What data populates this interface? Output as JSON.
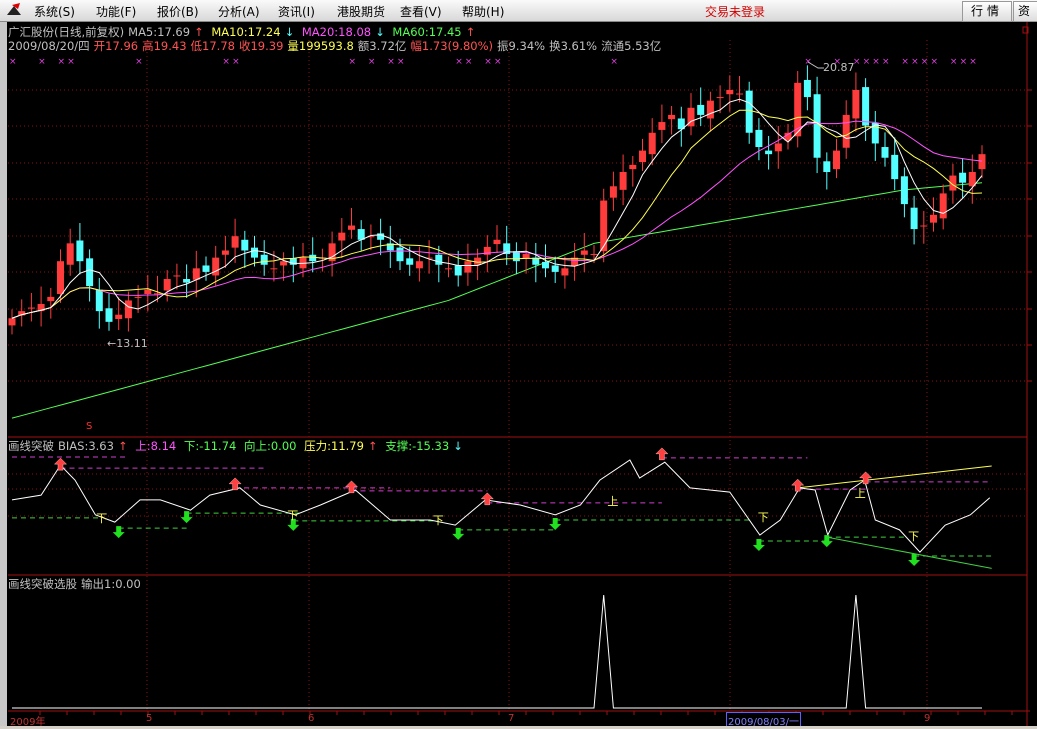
{
  "menu": {
    "items": [
      "系统(S)",
      "功能(F)",
      "报价(B)",
      "分析(A)",
      "资讯(I)",
      "港股期货",
      "查看(V)",
      "帮助(H)"
    ],
    "trade_status": "交易未登录",
    "buttons": [
      "行情",
      "资"
    ]
  },
  "main": {
    "title": "广汇股份(日线,前复权)",
    "ma5": "MA5:17.69",
    "ma10": "MA10:17.24",
    "ma20": "MA20:18.08",
    "ma60": "MA60:17.45",
    "date": "2009/08/20/四",
    "open": "开17.96",
    "high": "高19.43",
    "low": "低17.78",
    "close": "收19.39",
    "volume": "量199593.8",
    "amount": "额3.72亿",
    "change": "幅1.73(9.80%)",
    "amplitude": "振9.34%",
    "turnover": "换3.61%",
    "float": "流通5.53亿",
    "high_marker": "20.87",
    "low_marker": "←13.11",
    "s_marker": "S"
  },
  "indicator": {
    "name": "画线突破",
    "bias": "BIAS:3.63",
    "up": "上:8.14",
    "down": "下:-11.74",
    "upward": "向上:0.00",
    "pressure": "压力:11.79",
    "support": "支撑:-15.33",
    "label_down": "下",
    "label_up": "上"
  },
  "selector": {
    "name": "画线突破选股",
    "output": "输出1:0.00"
  },
  "xaxis": {
    "labels": [
      "2009年",
      "5",
      "6",
      "7",
      "9"
    ],
    "cursor_date": "2009/08/03/一"
  },
  "colors": {
    "up": "#ff3c3c",
    "down": "#54ffff",
    "ma5": "#ffffff",
    "ma10": "#ffff54",
    "ma20": "#ff54ff",
    "ma60": "#54ff54",
    "grid": "#8b1010"
  },
  "chart_data": {
    "type": "candlestick",
    "ylim": [
      10.4,
      21.5
    ],
    "first_open": 13.5,
    "closes": [
      13.7,
      13.9,
      14.0,
      14.1,
      14.3,
      15.3,
      15.8,
      15.3,
      14.6,
      13.9,
      13.6,
      13.8,
      14.2,
      14.3,
      14.5,
      14.4,
      14.8,
      14.9,
      14.7,
      15.1,
      15.0,
      15.4,
      15.6,
      16.0,
      15.6,
      15.4,
      15.2,
      15.1,
      15.3,
      15.2,
      15.4,
      15.3,
      15.4,
      15.8,
      16.1,
      16.3,
      15.9,
      16.0,
      15.9,
      15.6,
      15.3,
      15.2,
      15.3,
      15.4,
      15.2,
      15.1,
      14.9,
      15.3,
      15.4,
      15.7,
      15.9,
      15.5,
      15.3,
      15.5,
      15.2,
      15.1,
      15.0,
      15.1,
      15.4,
      15.6,
      15.5,
      17.0,
      17.4,
      17.8,
      18.0,
      18.4,
      18.9,
      19.2,
      19.4,
      19.0,
      19.6,
      19.4,
      19.8,
      19.9,
      20.1,
      20.0,
      18.9,
      18.5,
      18.3,
      18.6,
      18.9,
      20.3,
      19.9,
      18.2,
      17.8,
      18.4,
      19.4,
      20.1,
      19.1,
      18.6,
      18.2,
      17.6,
      16.9,
      16.2,
      16.3,
      16.6,
      17.2,
      17.7,
      17.5,
      17.8,
      18.3
    ],
    "ma60_anchors": [
      [
        0,
        10.9
      ],
      [
        45,
        14.2
      ],
      [
        60,
        15.8
      ],
      [
        75,
        16.5
      ],
      [
        92,
        17.3
      ],
      [
        100,
        17.5
      ]
    ],
    "markers_x": [
      0,
      3,
      5,
      6,
      13,
      22,
      23,
      35,
      37,
      39,
      40,
      46,
      47,
      49,
      50,
      62,
      82,
      85,
      87,
      88,
      89,
      90,
      92,
      93,
      94,
      95,
      97,
      98,
      99
    ],
    "bias": {
      "ylim": [
        -16,
        12
      ],
      "points": [
        [
          0,
          -0.1
        ],
        [
          3,
          1.0
        ],
        [
          5,
          8.0
        ],
        [
          6.5,
          4.5
        ],
        [
          8.6,
          -3.6
        ],
        [
          10.6,
          -5.3
        ],
        [
          13.2,
          -0.1
        ],
        [
          15.3,
          -0.1
        ],
        [
          18.4,
          -2.5
        ],
        [
          20.4,
          1.0
        ],
        [
          23.5,
          2.7
        ],
        [
          25.6,
          -1.3
        ],
        [
          29.2,
          -3.6
        ],
        [
          31.8,
          -1.3
        ],
        [
          35.4,
          2.2
        ],
        [
          39,
          -4.8
        ],
        [
          43.1,
          -4.8
        ],
        [
          45.7,
          -6.0
        ],
        [
          48.8,
          -0.1
        ],
        [
          52.4,
          -1.3
        ],
        [
          56,
          -3.6
        ],
        [
          58.6,
          -1.3
        ],
        [
          60.6,
          4.5
        ],
        [
          63.7,
          9.2
        ],
        [
          64.7,
          5.0
        ],
        [
          67.3,
          8.7
        ],
        [
          69.9,
          2.7
        ],
        [
          74,
          1.7
        ],
        [
          77.1,
          -8.3
        ],
        [
          79.2,
          -4.8
        ],
        [
          81.2,
          2.7
        ],
        [
          82.8,
          2.2
        ],
        [
          84.1,
          -8.3
        ],
        [
          86.4,
          2.2
        ],
        [
          87.9,
          4.5
        ],
        [
          89,
          -4.8
        ],
        [
          91.5,
          -7.1
        ],
        [
          93.6,
          -12.3
        ],
        [
          96.2,
          -6.0
        ],
        [
          98.8,
          -3.6
        ],
        [
          100.8,
          0.4
        ]
      ],
      "resistance": [
        [
          0,
          12,
          9.9
        ],
        [
          5,
          26,
          7.3
        ],
        [
          23,
          39,
          2.7
        ],
        [
          35,
          49,
          2.0
        ],
        [
          49,
          67,
          -0.8
        ],
        [
          67,
          82,
          9.7
        ],
        [
          81,
          88,
          2.4
        ],
        [
          88,
          101,
          4.1
        ]
      ],
      "support": [
        [
          0,
          9,
          -4.3
        ],
        [
          11,
          18,
          -6.7
        ],
        [
          18,
          30,
          -3.2
        ],
        [
          29,
          44,
          -5.0
        ],
        [
          46,
          56,
          -7.1
        ],
        [
          56,
          76,
          -4.8
        ],
        [
          77,
          84,
          -9.7
        ],
        [
          84,
          92,
          -8.8
        ],
        [
          93,
          101,
          -13.2
        ]
      ],
      "trend_up": [
        [
          81,
          2.7
        ],
        [
          101,
          7.8
        ]
      ],
      "trend_down": [
        [
          84,
          -8.8
        ],
        [
          101,
          -16.1
        ]
      ],
      "up_arrows": [
        [
          5,
          7.3
        ],
        [
          23,
          2.7
        ],
        [
          35,
          2.0
        ],
        [
          49,
          -0.8
        ],
        [
          67,
          9.7
        ],
        [
          81,
          2.4
        ],
        [
          88,
          4.1
        ]
      ],
      "down_arrows": [
        [
          11,
          -6.7
        ],
        [
          18,
          -3.2
        ],
        [
          29,
          -5.0
        ],
        [
          46,
          -7.1
        ],
        [
          56,
          -4.8
        ],
        [
          77,
          -9.7
        ],
        [
          84,
          -8.8
        ],
        [
          93,
          -13.2
        ]
      ],
      "down_labels": [
        [
          9.3,
          -4.3
        ],
        [
          29,
          -3.6
        ],
        [
          44,
          -4.8
        ],
        [
          77.5,
          -4.0
        ],
        [
          93,
          -8.5
        ]
      ],
      "up_labels": [
        [
          62,
          -0.3
        ],
        [
          87.5,
          1.5
        ]
      ]
    },
    "signal": {
      "indices": [
        61,
        87
      ],
      "ylim": [
        0,
        1
      ]
    }
  }
}
